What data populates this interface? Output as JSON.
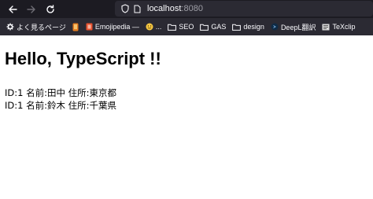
{
  "browser": {
    "url_host": "localhost",
    "url_port": ":8080",
    "bookmarks": [
      {
        "label": "よく見るページ",
        "icon": "gear-icon"
      },
      {
        "label": "",
        "icon": "tab-icon"
      },
      {
        "label": "Emojipedia —",
        "icon": "emojipedia-favicon"
      },
      {
        "label": "...",
        "icon": "smiley-icon"
      },
      {
        "label": "SEO",
        "icon": "folder-icon"
      },
      {
        "label": "GAS",
        "icon": "folder-icon"
      },
      {
        "label": "design",
        "icon": "folder-icon"
      },
      {
        "label": "DeepL翻訳",
        "icon": "deepl-favicon"
      },
      {
        "label": "TeXclip",
        "icon": "texclip-favicon"
      }
    ]
  },
  "page": {
    "heading": "Hello, TypeScript !!",
    "users": [
      "ID:1 名前:田中 住所:東京都",
      "ID:1 名前:鈴木 住所:千葉県"
    ]
  }
}
